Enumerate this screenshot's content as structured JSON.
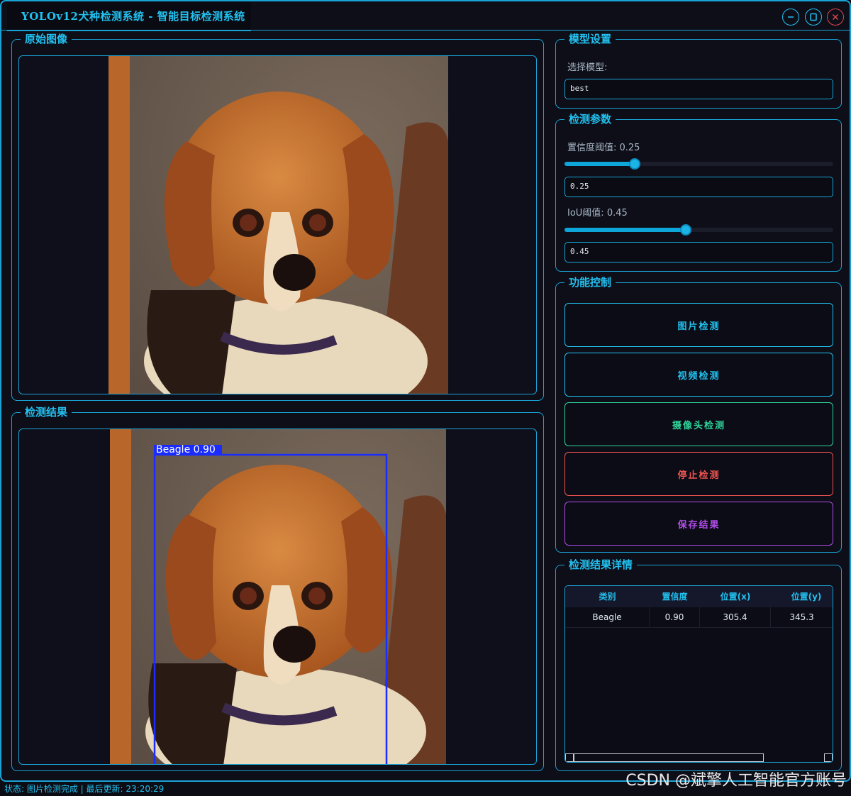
{
  "window": {
    "title": "YOLOv12犬种检测系统 - 智能目标检测系统"
  },
  "panels": {
    "original": {
      "title": "原始图像"
    },
    "result": {
      "title": "检测结果",
      "detection_label": "Beagle 0.90"
    },
    "model": {
      "title": "模型设置",
      "select_label": "选择模型:",
      "selected_model": "best"
    },
    "params": {
      "title": "检测参数",
      "confidence_label": "置信度阈值: 0.25",
      "confidence_value": "0.25",
      "confidence_level": 0.25,
      "iou_label": "IoU阈值: 0.45",
      "iou_value": "0.45",
      "iou_level": 0.45
    },
    "controls": {
      "title": "功能控制",
      "buttons": [
        {
          "label": "图片检测",
          "color": "#22c1f0"
        },
        {
          "label": "视频检测",
          "color": "#22c1f0"
        },
        {
          "label": "摄像头检测",
          "color": "#2fd69a"
        },
        {
          "label": "停止检测",
          "color": "#ef5350"
        },
        {
          "label": "保存结果",
          "color": "#b04de8"
        }
      ]
    },
    "details": {
      "title": "检测结果详情",
      "columns": [
        "类别",
        "置信度",
        "位置(x)",
        "位置(y)"
      ],
      "rows": [
        [
          "Beagle",
          "0.90",
          "305.4",
          "345.3"
        ]
      ]
    }
  },
  "status": "状态: 图片检测完成 | 最后更新: 23:20:29",
  "watermark": "CSDN @斌擎人工智能官方账号",
  "colors": {
    "accent": "#1aa3d6",
    "title": "#22c1f0",
    "background": "#0d0e18"
  }
}
